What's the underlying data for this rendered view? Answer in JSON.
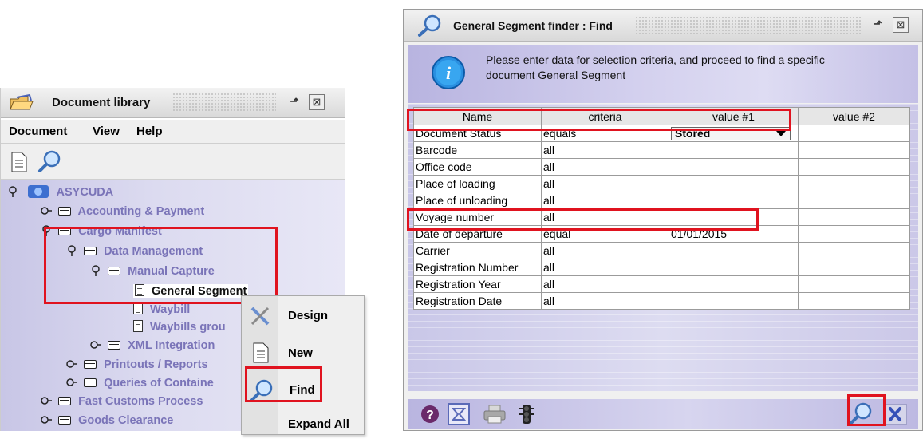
{
  "library": {
    "title": "Document library",
    "menu": [
      "Document",
      "View",
      "Help"
    ],
    "toolbar_icons": [
      "document-icon",
      "search-icon"
    ],
    "tree": {
      "root": "ASYCUDA",
      "accounting": "Accounting & Payment",
      "cargo_manifest": "Cargo Manifest",
      "data_management": "Data Management",
      "manual_capture": "Manual Capture",
      "general_segment": "General Segment",
      "waybill": "Waybill",
      "waybills_group": "Waybills grou",
      "xml_integration": "XML Integration",
      "printouts": "Printouts / Reports",
      "queries": "Queries of Containe",
      "fast_customs": "Fast Customs Process",
      "goods_clearance": "Goods Clearance"
    },
    "context_menu": {
      "design": "Design",
      "new": "New",
      "find": "Find",
      "expand_all": "Expand All"
    }
  },
  "finder": {
    "title": "General Segment finder : Find",
    "message_line1": "Please enter data for selection criteria, and proceed to find a specific",
    "message_line2": "document General Segment",
    "columns": [
      "Name",
      "criteria",
      "value #1",
      "value #2"
    ],
    "rows": [
      {
        "name": "Document Status",
        "criteria": "equals",
        "value1": "Stored",
        "value2": ""
      },
      {
        "name": "Barcode",
        "criteria": "all",
        "value1": "",
        "value2": ""
      },
      {
        "name": "Office code",
        "criteria": "all",
        "value1": "",
        "value2": ""
      },
      {
        "name": "Place of loading",
        "criteria": "all",
        "value1": "",
        "value2": ""
      },
      {
        "name": "Place of unloading",
        "criteria": "all",
        "value1": "",
        "value2": ""
      },
      {
        "name": "Voyage number",
        "criteria": "all",
        "value1": "",
        "value2": ""
      },
      {
        "name": "Date of departure",
        "criteria": "equal",
        "value1": "01/01/2015",
        "value2": ""
      },
      {
        "name": "Carrier",
        "criteria": "all",
        "value1": "",
        "value2": ""
      },
      {
        "name": "Registration Number",
        "criteria": "all",
        "value1": "",
        "value2": ""
      },
      {
        "name": "Registration Year",
        "criteria": "all",
        "value1": "",
        "value2": ""
      },
      {
        "name": "Registration Date",
        "criteria": "all",
        "value1": "",
        "value2": ""
      }
    ],
    "bottom_icons": [
      "help-icon",
      "clear-filter-icon",
      "print-icon",
      "traffic-light-icon",
      "search-icon",
      "close-icon"
    ]
  },
  "colors": {
    "annotation_red": "#e0131f",
    "tree_label_purple": "#7a74b8",
    "panel_lavender": "#d3d0ee"
  }
}
